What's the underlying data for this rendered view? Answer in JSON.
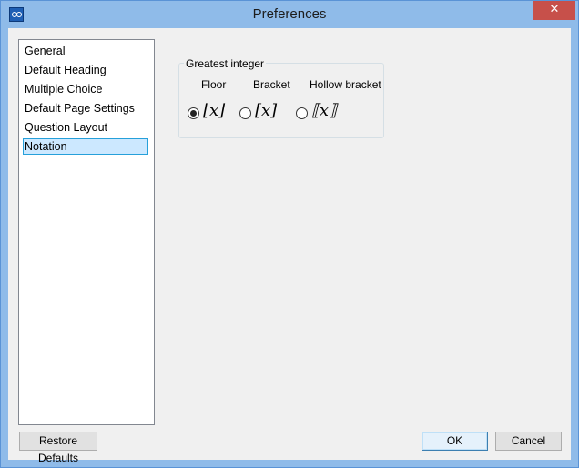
{
  "window": {
    "title": "Preferences",
    "close_label": "✕"
  },
  "sidebar": {
    "items": [
      {
        "label": "General",
        "selected": false
      },
      {
        "label": "Default Heading",
        "selected": false
      },
      {
        "label": "Multiple Choice",
        "selected": false
      },
      {
        "label": "Default Page Settings",
        "selected": false
      },
      {
        "label": "Question Layout",
        "selected": false
      },
      {
        "label": "Notation",
        "selected": true
      }
    ]
  },
  "notation": {
    "group_label": "Greatest integer",
    "options": [
      {
        "label": "Floor",
        "glyph": "⌊x⌋",
        "checked": true
      },
      {
        "label": "Bracket",
        "glyph": "[x]",
        "checked": false
      },
      {
        "label": "Hollow bracket",
        "glyph": "⟦x⟧",
        "checked": false
      }
    ]
  },
  "buttons": {
    "restore": "Restore Defaults",
    "ok": "OK",
    "cancel": "Cancel"
  },
  "colors": {
    "titlebar": "#8fbbe9",
    "close": "#c7504a",
    "selection": "#cce8ff"
  }
}
